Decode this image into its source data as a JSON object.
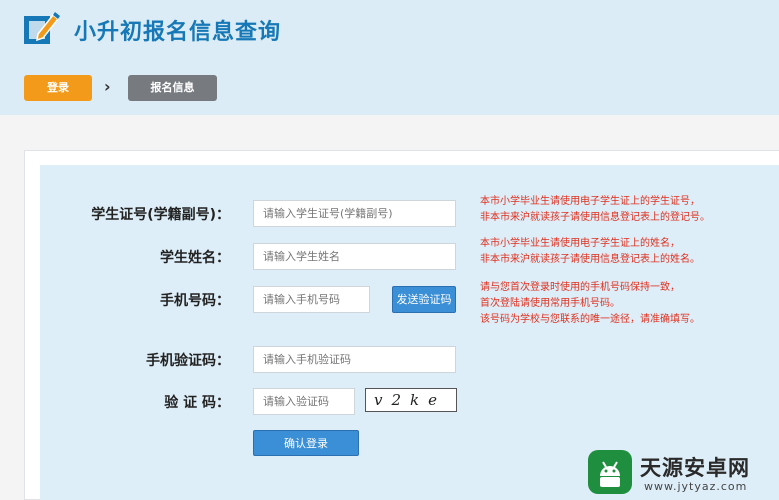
{
  "app": {
    "title": "小升初报名信息查询"
  },
  "steps": {
    "login": "登录",
    "info": "报名信息"
  },
  "form": {
    "student_id": {
      "label": "学生证号(学籍副号)：",
      "placeholder": "请输入学生证号(学籍副号)"
    },
    "student_name": {
      "label": "学生姓名：",
      "placeholder": "请输入学生姓名"
    },
    "phone": {
      "label": "手机号码：",
      "placeholder": "请输入手机号码",
      "send_code_button": "发送验证码"
    },
    "sms_code": {
      "label": "手机验证码：",
      "placeholder": "请输入手机验证码"
    },
    "captcha": {
      "label": "验 证 码：",
      "placeholder": "请输入验证码",
      "image_text": "v2ke"
    },
    "submit_button": "确认登录"
  },
  "notes": {
    "student_id": [
      "本市小学毕业生请使用电子学生证上的学生证号，",
      "非本市来沪就读孩子请使用信息登记表上的登记号。"
    ],
    "student_name": [
      "本市小学毕业生请使用电子学生证上的姓名，",
      "非本市来沪就读孩子请使用信息登记表上的姓名。"
    ],
    "phone": [
      "请与您首次登录时使用的手机号码保持一致，",
      "首次登陆请使用常用手机号码。",
      "该号码为学校与您联系的唯一途径，请准确填写。"
    ]
  },
  "watermark": {
    "name": "天源安卓网",
    "url": "www.jytyaz.com"
  },
  "colors": {
    "accent": "#1678b7",
    "orange": "#f39a1a",
    "note_red": "#e0301e",
    "button_blue": "#3b8fd6"
  }
}
